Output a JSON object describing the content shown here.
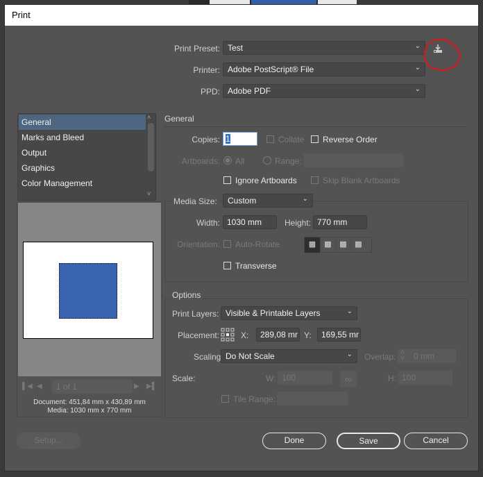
{
  "window": {
    "title": "Print"
  },
  "preset": {
    "label": "Print Preset:",
    "value": "Test",
    "save_icon": "save-preset-icon"
  },
  "printer": {
    "label": "Printer:",
    "value": "Adobe PostScript® File"
  },
  "ppd": {
    "label": "PPD:",
    "value": "Adobe PDF"
  },
  "sidebar": {
    "items": [
      {
        "label": "General",
        "selected": true
      },
      {
        "label": "Marks and Bleed"
      },
      {
        "label": "Output"
      },
      {
        "label": "Graphics"
      },
      {
        "label": "Color Management"
      }
    ]
  },
  "preview": {
    "pager": "1 of 1",
    "document": "Document: 451,84 mm x 430,89 mm",
    "media": "Media: 1030 mm x 770 mm",
    "artwork_color": "#3a64b0"
  },
  "general": {
    "title": "General",
    "copies_label": "Copies:",
    "copies_value": "1",
    "collate": "Collate",
    "reverse_order": "Reverse Order",
    "artboards_label": "Artboards:",
    "all": "All",
    "range": "Range:",
    "ignore_artboards": "Ignore Artboards",
    "skip_blank": "Skip Blank Artboards",
    "media_size_label": "Media Size:",
    "media_size_value": "Custom",
    "width_label": "Width:",
    "width_value": "1030 mm",
    "height_label": "Height:",
    "height_value": "770 mm",
    "orientation_label": "Orientation:",
    "auto_rotate": "Auto-Rotate",
    "transverse": "Transverse"
  },
  "options": {
    "title": "Options",
    "print_layers_label": "Print Layers:",
    "print_layers_value": "Visible & Printable Layers",
    "placement_label": "Placement:",
    "x_label": "X:",
    "x_value": "289,08 mr",
    "y_label": "Y:",
    "y_value": "169,55 mr",
    "scaling_label": "Scaling:",
    "scaling_value": "Do Not Scale",
    "overlap_label": "Overlap:",
    "overlap_value": "0 mm",
    "scale_label": "Scale:",
    "w_label": "W:",
    "w_value": "100",
    "h_label": "H:",
    "h_value": "100",
    "tile_range": "Tile Range:"
  },
  "buttons": {
    "setup": "Setup...",
    "done": "Done",
    "save": "Save",
    "cancel": "Cancel"
  },
  "annotation_color": "#e0141c"
}
